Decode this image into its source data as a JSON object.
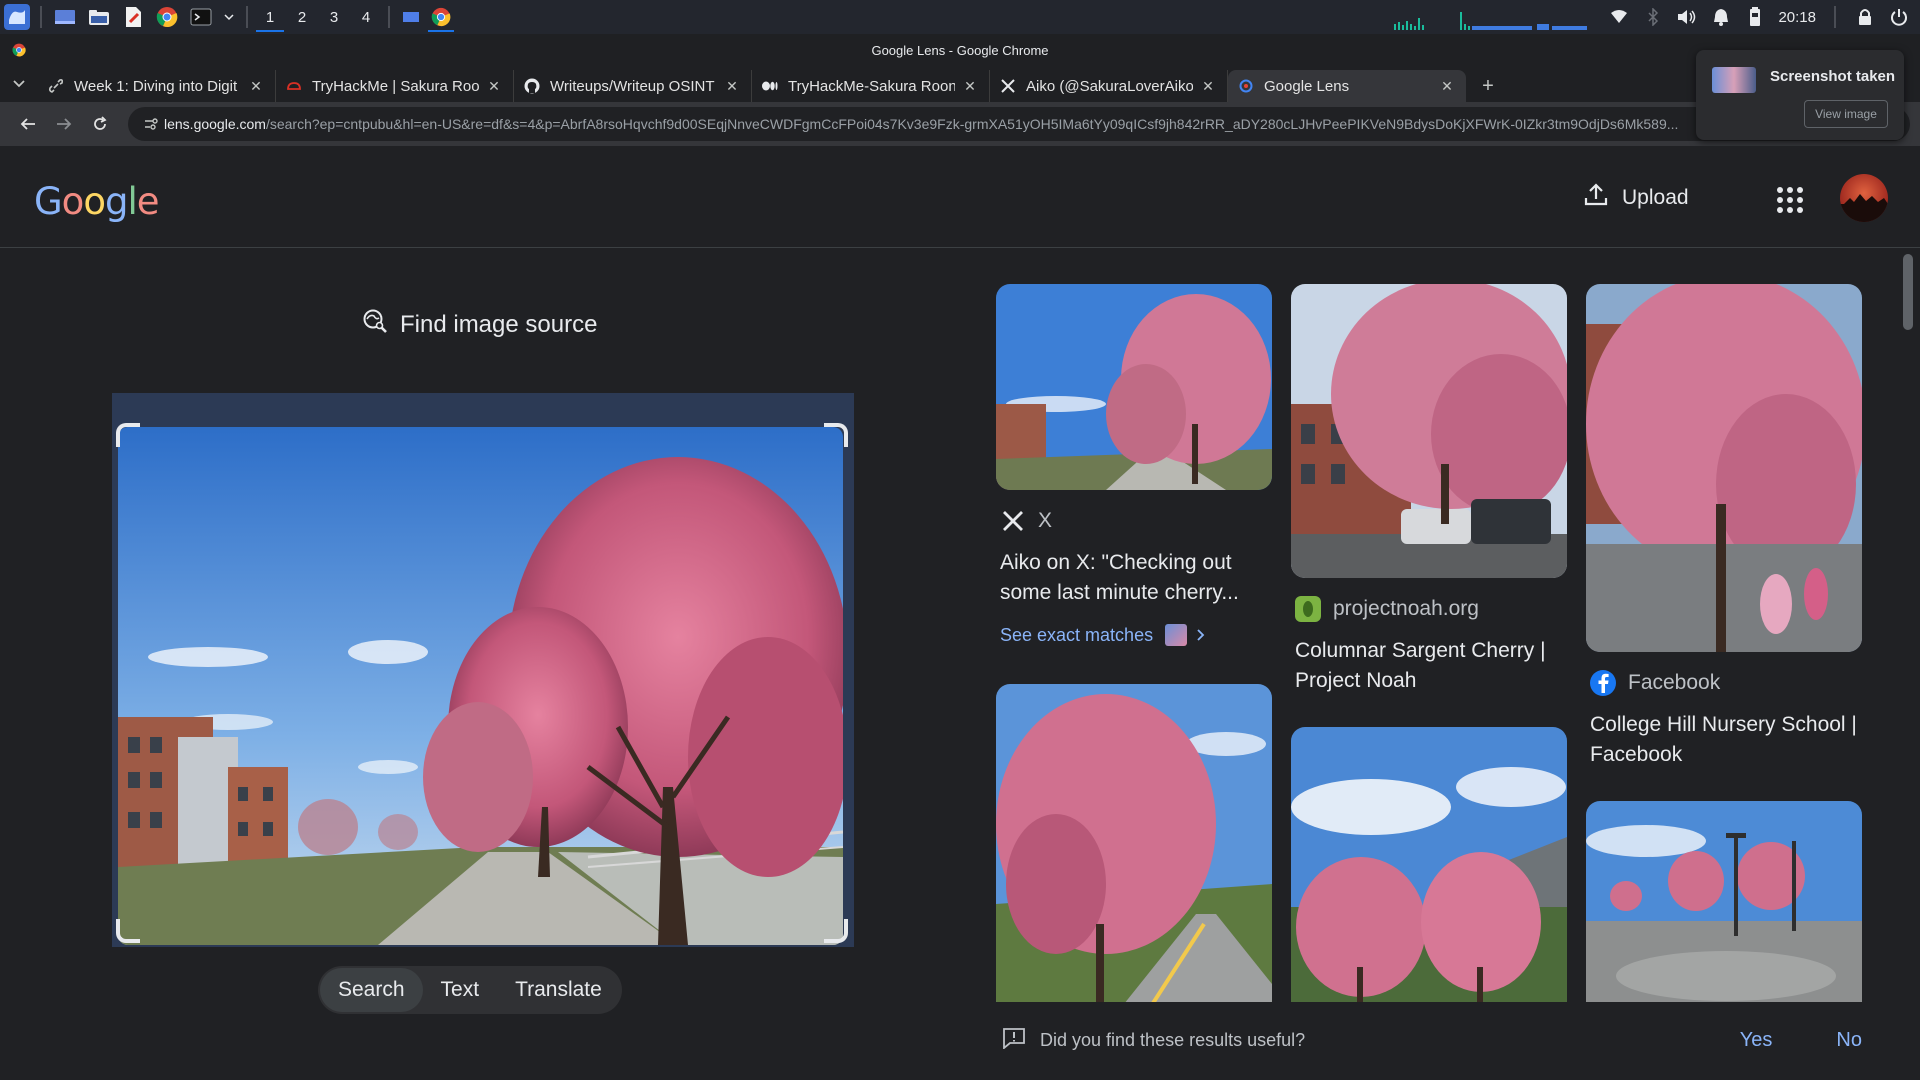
{
  "taskbar": {
    "workspaces": [
      "1",
      "2",
      "3",
      "4"
    ],
    "active_workspace": "1",
    "clock": "20:18",
    "icons": [
      "app-launcher-icon",
      "desktop-icon",
      "file-manager-icon",
      "pdf-icon",
      "chrome-icon",
      "terminal-icon",
      "wifi-icon",
      "bluetooth-icon",
      "volume-icon",
      "bell-icon",
      "battery-icon",
      "lock-icon",
      "power-icon"
    ]
  },
  "window": {
    "title": "Google Lens - Google Chrome"
  },
  "tabs": [
    {
      "label": "Week 1: Diving into Digit",
      "favicon": "link-icon",
      "active": false
    },
    {
      "label": "TryHackMe | Sakura Roor",
      "favicon": "tryhackme-icon",
      "active": false
    },
    {
      "label": "Writeups/Writeup OSINT",
      "favicon": "github-icon",
      "active": false
    },
    {
      "label": "TryHackMe-Sakura Roon",
      "favicon": "medium-icon",
      "active": false
    },
    {
      "label": "Aiko (@SakuraLoverAiko",
      "favicon": "x-icon",
      "active": false
    },
    {
      "label": "Google Lens",
      "favicon": "lens-icon",
      "active": true
    }
  ],
  "omnibox": {
    "host": "lens.google.com",
    "path": "/search?ep=cntpubu&hl=en-US&re=df&s=4&p=AbrfA8rsoHqvchf9d00SEqjNnveCWDFgmCcFPoi04s7Kv3e9Fzk-grmXA51yOH5IMa6tYy09qICsf9jh842rRR_aDY280cLJHvPeePIKVeN9BdysDoKjXFWrK-0IZkr3tm9OdjDs6Mk589..."
  },
  "screenshot_popup": {
    "title": "Screenshot taken",
    "button": "View image"
  },
  "lens": {
    "logo_letters": [
      {
        "ch": "G",
        "color": "#8ab4f8"
      },
      {
        "ch": "o",
        "color": "#f28b82"
      },
      {
        "ch": "o",
        "color": "#fdd663"
      },
      {
        "ch": "g",
        "color": "#8ab4f8"
      },
      {
        "ch": "l",
        "color": "#81c995"
      },
      {
        "ch": "e",
        "color": "#f28b82"
      }
    ],
    "upload_label": "Upload",
    "find_source_label": "Find image source",
    "modes": [
      "Search",
      "Text",
      "Translate"
    ],
    "active_mode": "Search"
  },
  "results": [
    {
      "source": "X",
      "source_icon": "x-icon",
      "title": "Aiko on X: \"Checking out some last minute cherry...",
      "exact_matches": "See exact matches"
    },
    {
      "source": "projectnoah.org",
      "source_icon": "projectnoah-icon",
      "title": "Columnar Sargent Cherry | Project Noah"
    },
    {
      "source": "Facebook",
      "source_icon": "facebook-icon",
      "title": "College Hill Nursery School | Facebook"
    }
  ],
  "feedback": {
    "question": "Did you find these results useful?",
    "yes": "Yes",
    "no": "No"
  },
  "colors": {
    "page_bg": "#202124",
    "link_blue": "#8ab4f8",
    "blossom_pink": "#d9658d",
    "sky_blue": "#4d8fd8"
  }
}
